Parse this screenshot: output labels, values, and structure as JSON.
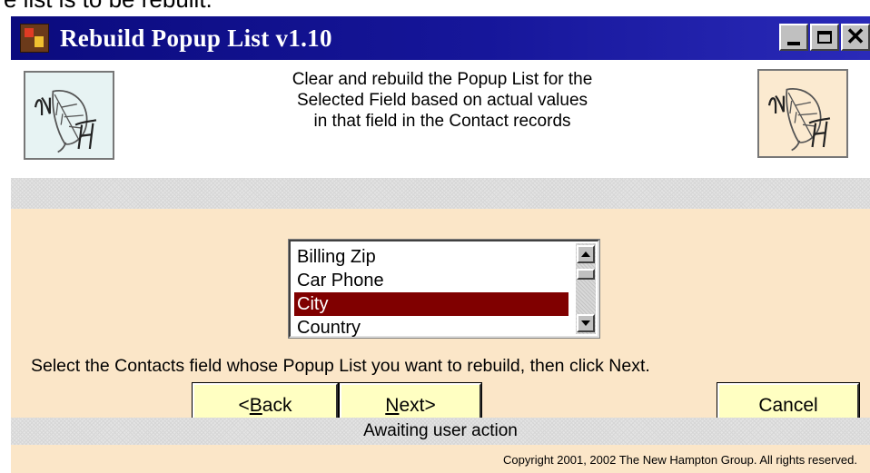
{
  "caption": {
    "text": "e list is to be rebuilt."
  },
  "window": {
    "title": "Rebuild Popup List v1.10",
    "app_icon": "app-icon",
    "controls": {
      "minimize_icon": "minimize-icon",
      "maximize_icon": "maximize-icon",
      "close_icon": "close-icon",
      "close_glyph": "✕"
    }
  },
  "header": {
    "description": "Clear and rebuild the Popup List for the Selected Field based on actual values in that field in the Contact records",
    "logo_left_icon": "nh-leaf-logo",
    "logo_right_icon": "nh-leaf-logo"
  },
  "field_list": {
    "items": [
      {
        "label": "Billing Zip",
        "selected": false
      },
      {
        "label": "Car Phone",
        "selected": false
      },
      {
        "label": "City",
        "selected": true
      },
      {
        "label": "Country",
        "selected": false
      }
    ],
    "selected_value": "City"
  },
  "instruction": "Select the Contacts field whose Popup List you want to rebuild, then click Next.",
  "buttons": {
    "back_prefix": "<",
    "back_accel": "B",
    "back_rest": "ack",
    "next_accel": "N",
    "next_rest": "ext>",
    "cancel": "Cancel"
  },
  "status": "Awaiting user action",
  "copyright": "Copyright 2001, 2002 The New Hampton Group.  All rights reserved.",
  "colors": {
    "title_bar": "#0b0b7e",
    "content_bg": "#fbe6c8",
    "button_bg": "#ffffc2",
    "selection": "#800000"
  }
}
